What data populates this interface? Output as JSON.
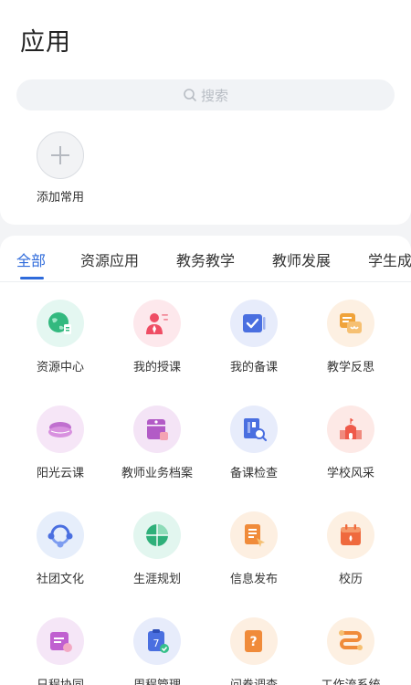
{
  "header": {
    "title": "应用"
  },
  "search": {
    "placeholder": "搜索"
  },
  "favorites": {
    "add_label": "添加常用"
  },
  "tabs": [
    {
      "label": "全部",
      "active": true
    },
    {
      "label": "资源应用",
      "active": false
    },
    {
      "label": "教务教学",
      "active": false
    },
    {
      "label": "教师发展",
      "active": false
    },
    {
      "label": "学生成",
      "active": false
    }
  ],
  "apps": [
    {
      "label": "资源中心",
      "icon": "globe-icon",
      "bg": "#e4f7f1"
    },
    {
      "label": "我的授课",
      "icon": "teacher-icon",
      "bg": "#fde8ec"
    },
    {
      "label": "我的备课",
      "icon": "checkbox-book-icon",
      "bg": "#e7ecfb"
    },
    {
      "label": "教学反思",
      "icon": "reflection-icon",
      "bg": "#fdf0e2"
    },
    {
      "label": "阳光云课",
      "icon": "cloud-icon",
      "bg": "#f6e6f7"
    },
    {
      "label": "教师业务档案",
      "icon": "archive-icon",
      "bg": "#f4e4f6"
    },
    {
      "label": "备课检查",
      "icon": "search-book-icon",
      "bg": "#e7ecfb"
    },
    {
      "label": "学校风采",
      "icon": "school-icon",
      "bg": "#fde9e6"
    },
    {
      "label": "社团文化",
      "icon": "community-icon",
      "bg": "#e6eefb"
    },
    {
      "label": "生涯规划",
      "icon": "pie-chart-icon",
      "bg": "#e2f6ef"
    },
    {
      "label": "信息发布",
      "icon": "document-icon",
      "bg": "#fdefe1"
    },
    {
      "label": "校历",
      "icon": "calendar-icon",
      "bg": "#fdf0e2"
    },
    {
      "label": "日程协同",
      "icon": "schedule-icon",
      "bg": "#f5e6f7"
    },
    {
      "label": "周程管理",
      "icon": "week-calendar-icon",
      "bg": "#e7ecfb"
    },
    {
      "label": "问卷调查",
      "icon": "question-icon",
      "bg": "#fdefe1"
    },
    {
      "label": "工作流系统",
      "icon": "workflow-icon",
      "bg": "#fdf0e2"
    }
  ]
}
